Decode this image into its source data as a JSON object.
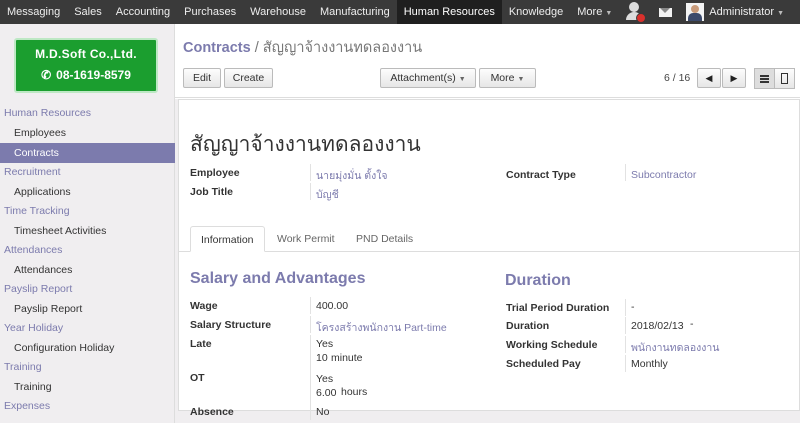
{
  "topbar": {
    "menus": [
      "Messaging",
      "Sales",
      "Accounting",
      "Purchases",
      "Warehouse",
      "Manufacturing",
      "Human Resources",
      "Knowledge",
      "More"
    ],
    "user": "Administrator"
  },
  "logo": {
    "company": "M.D.Soft Co.,Ltd.",
    "phone": "08-1619-8579"
  },
  "sidebar": {
    "hr_section": "Human Resources",
    "employees": "Employees",
    "contracts": "Contracts",
    "recruitment_section": "Recruitment",
    "applications": "Applications",
    "time_tracking_section": "Time Tracking",
    "timesheet_activities": "Timesheet Activities",
    "attendances_section": "Attendances",
    "attendances": "Attendances",
    "payslip_section": "Payslip Report",
    "payslip_report": "Payslip Report",
    "year_holiday_section": "Year Holiday",
    "configuration_holiday": "Configuration Holiday",
    "training_section": "Training",
    "training": "Training",
    "expenses_section": "Expenses"
  },
  "breadcrumb": {
    "parent": "Contracts",
    "separator": "/",
    "current": "สัญญาจ้างงานทดลองงาน"
  },
  "toolbar": {
    "edit": "Edit",
    "create": "Create",
    "attachments": "Attachment(s)",
    "more": "More",
    "pager": "6 / 16"
  },
  "form": {
    "title": "สัญญาจ้างงานทดลองงาน",
    "employee_label": "Employee",
    "employee_value": "นายมุ่งมั่น ตั้งใจ",
    "job_title_label": "Job Title",
    "job_title_value": "บัญชี",
    "contract_type_label": "Contract Type",
    "contract_type_value": "Subcontractor"
  },
  "tabs": [
    "Information",
    "Work Permit",
    "PND Details"
  ],
  "salary": {
    "heading": "Salary and Advantages",
    "wage_label": "Wage",
    "wage_value": "400.00",
    "structure_label": "Salary Structure",
    "structure_value": "โครงสร้างพนักงาน Part-time",
    "late_label": "Late",
    "late_value": "Yes",
    "late_amount": "10",
    "late_unit": "minute",
    "ot_label": "OT",
    "ot_value": "Yes",
    "ot_amount": "6.00",
    "ot_unit": "hours",
    "absence_label": "Absence",
    "absence_value": "No"
  },
  "duration": {
    "heading": "Duration",
    "trial_label": "Trial Period Duration",
    "trial_value": "-",
    "duration_label": "Duration",
    "duration_value": "2018/02/13",
    "duration_end": "-",
    "schedule_label": "Working Schedule",
    "schedule_value": "พนักงานทดลองงาน",
    "pay_label": "Scheduled Pay",
    "pay_value": "Monthly"
  }
}
